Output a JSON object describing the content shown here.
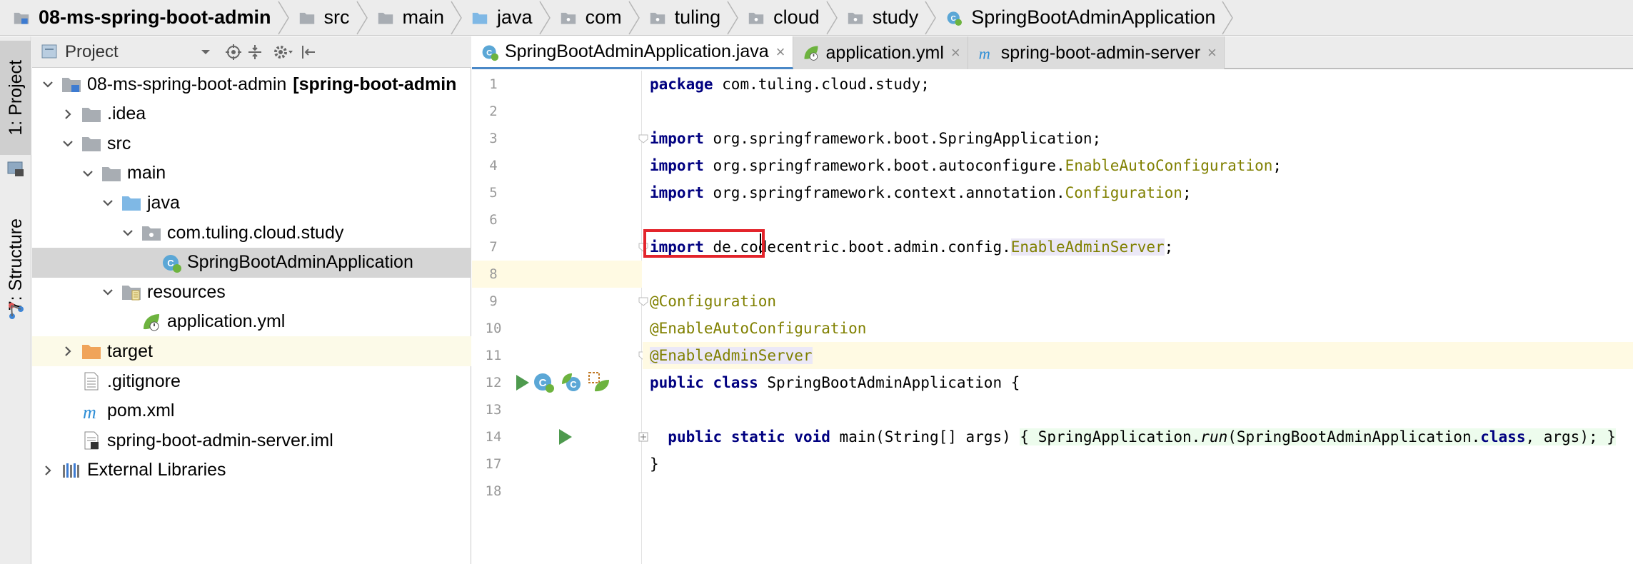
{
  "breadcrumb": [
    {
      "label": "08-ms-spring-boot-admin",
      "icon": "module-folder-icon",
      "bold": true
    },
    {
      "label": "src",
      "icon": "folder-icon"
    },
    {
      "label": "main",
      "icon": "folder-icon"
    },
    {
      "label": "java",
      "icon": "source-folder-icon"
    },
    {
      "label": "com",
      "icon": "package-icon"
    },
    {
      "label": "tuling",
      "icon": "package-icon"
    },
    {
      "label": "cloud",
      "icon": "package-icon"
    },
    {
      "label": "study",
      "icon": "package-icon"
    },
    {
      "label": "SpringBootAdminApplication",
      "icon": "spring-boot-class-icon"
    }
  ],
  "left_strip": {
    "project_tab": "1: Project",
    "structure_tab": "7: Structure"
  },
  "project_panel": {
    "title": "Project",
    "dropdown_icon": "chevron-down-icon",
    "toolbar_icons": [
      "locate-icon",
      "collapse-all-icon",
      "gear-icon",
      "hide-icon"
    ]
  },
  "tree": [
    {
      "label": "08-ms-spring-boot-admin",
      "suffix": "[spring-boot-admin",
      "indent": 0,
      "expanded": true,
      "icon": "module-folder-icon"
    },
    {
      "label": ".idea",
      "indent": 1,
      "expanded": false,
      "icon": "folder-icon"
    },
    {
      "label": "src",
      "indent": 1,
      "expanded": true,
      "icon": "folder-icon"
    },
    {
      "label": "main",
      "indent": 2,
      "expanded": true,
      "icon": "folder-icon"
    },
    {
      "label": "java",
      "indent": 3,
      "expanded": true,
      "icon": "source-folder-icon"
    },
    {
      "label": "com.tuling.cloud.study",
      "indent": 4,
      "expanded": true,
      "icon": "package-icon"
    },
    {
      "label": "SpringBootAdminApplication",
      "indent": 5,
      "icon": "spring-boot-class-icon",
      "selected": true
    },
    {
      "label": "resources",
      "indent": 3,
      "expanded": true,
      "icon": "resources-folder-icon"
    },
    {
      "label": "application.yml",
      "indent": 4,
      "icon": "spring-yml-icon"
    },
    {
      "label": "target",
      "indent": 1,
      "expanded": false,
      "icon": "excluded-folder-icon",
      "excluded": true
    },
    {
      "label": ".gitignore",
      "indent": 1,
      "icon": "text-file-icon"
    },
    {
      "label": "pom.xml",
      "indent": 1,
      "icon": "maven-icon"
    },
    {
      "label": "spring-boot-admin-server.iml",
      "indent": 1,
      "icon": "iml-file-icon"
    },
    {
      "label": "External Libraries",
      "indent": 0,
      "expanded": false,
      "icon": "libraries-icon"
    }
  ],
  "tabs": [
    {
      "label": "SpringBootAdminApplication.java",
      "icon": "spring-boot-class-icon",
      "active": true
    },
    {
      "label": "application.yml",
      "icon": "spring-yml-icon"
    },
    {
      "label": "spring-boot-admin-server",
      "icon": "maven-icon"
    }
  ],
  "tab_close": "×",
  "line_numbers": [
    "1",
    "2",
    "3",
    "4",
    "5",
    "6",
    "7",
    "8",
    "9",
    "10",
    "11",
    "12",
    "13",
    "14",
    "17",
    "18"
  ],
  "code": {
    "l1_kw": "package",
    "l1_rest": " com.tuling.cloud.study;",
    "import_kw": "import",
    "l3_rest": " org.springframework.boot.SpringApplication;",
    "l4_pkg": " org.springframework.boot.autoconfigure.",
    "l4_cls": "EnableAutoConfiguration",
    "l5_pkg": " org.springframework.context.annotation.",
    "l5_cls": "Configuration",
    "l7_pkg": " de.codecentric.boot.admin.config.",
    "l7_cls": "EnableAdminServer",
    "semicolon": ";",
    "l9": "@Configuration",
    "l10": "@EnableAutoConfiguration",
    "l11": "@EnableAdminServer",
    "l12_kw1": "public",
    "l12_kw2": "class",
    "l12_rest": " SpringBootAdminApplication {",
    "l14_kw1": "public",
    "l14_kw2": "static",
    "l14_kw3": "void",
    "l14_mid": " main(String[] args) ",
    "l14_open": "{",
    "l14_call1": " SpringApplication.",
    "l14_run": "run",
    "l14_call2": "(SpringBootAdminApplication.",
    "l14_class": "class",
    "l14_call3": ", args); ",
    "l14_close": "}",
    "l17": "}"
  }
}
